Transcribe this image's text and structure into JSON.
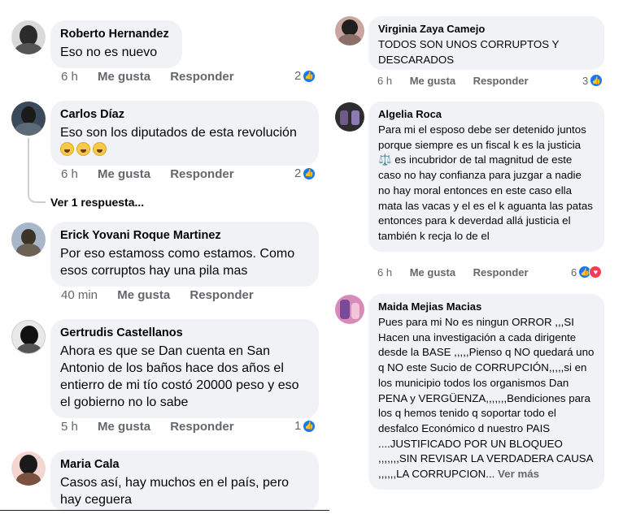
{
  "left_comments": [
    {
      "author": "Roberto Hernandez",
      "text": "Eso no es nuevo",
      "time": "6 h",
      "like_label": "Me gusta",
      "reply_label": "Responder",
      "reactions": "2",
      "avatar_colors": [
        "#d9d9d9",
        "#2b2b2b"
      ]
    },
    {
      "author": "Carlos Díaz",
      "text": "Eso son los diputados de esta revolución",
      "emojis": [
        "rofl-emoji",
        "grin-emoji",
        "smile-emoji"
      ],
      "time": "6 h",
      "like_label": "Me gusta",
      "reply_label": "Responder",
      "reactions": "2",
      "view_replies": "Ver 1 respuesta...",
      "avatar_colors": [
        "#3b4a5a",
        "#1a1a1a"
      ]
    },
    {
      "author": "Erick Yovani Roque Martinez",
      "text": "Por eso estamoss como estamos. Como esos corruptos hay una pila mas",
      "time": "40 min",
      "like_label": "Me gusta",
      "reply_label": "Responder",
      "avatar_colors": [
        "#a7b6c8",
        "#3d3428"
      ]
    },
    {
      "author": "Gertrudis Castellanos",
      "text": "Ahora es que se Dan cuenta en San Antonio de los baños hace dos años el entierro de mi tío costó 20000 peso y eso el gobierno no lo sabe",
      "time": "5 h",
      "like_label": "Me gusta",
      "reply_label": "Responder",
      "reactions": "1",
      "avatar_colors": [
        "#e8e8e8",
        "#111111"
      ]
    },
    {
      "author": "Maria Cala",
      "text": "Casos así,  hay muchos  en el país,  pero hay ceguera",
      "avatar_colors": [
        "#f4d5d0",
        "#1a1a1a"
      ]
    }
  ],
  "right_comments": [
    {
      "author": "Virginia Zaya Camejo",
      "text": "TODOS SON UNOS CORRUPTOS Y DESCARADOS",
      "time": "6 h",
      "like_label": "Me gusta",
      "reply_label": "Responder",
      "reactions": "3",
      "avatar_colors": [
        "#c9a7a0",
        "#1f1f1f"
      ]
    },
    {
      "author": "Algelia Roca",
      "text": "Para mi el esposo debe  ser detenido juntos porque  siempre es un fiscal k es la justicia ⚖️ es incubridor  de tal magnitud  de este caso no hay confianza para juzgar a nadie no hay moral entonces en este caso ella mata las vacas y el es el k aguanta las patas entonces  para k deverdad allá  justicia el también  k recja lo de el",
      "time": "6 h",
      "like_label": "Me gusta",
      "reply_label": "Responder",
      "reactions": "6",
      "avatar_colors": [
        "#2d2d2d",
        "#6e5b8a"
      ]
    },
    {
      "author": "Maida Mejias Macias",
      "text": "Pues para mi No es ningun ORROR ,,,SI Hacen una investigación a cada dirigente desde la BASE ,,,,,Pienso q NO quedará uno q NO este Sucio de CORRUPCIÓN,,,,,si en los municipio todos los organismos Dan PENA y VERGÜENZA,,,,,,,Bendiciones para los q hemos tenido q soportar todo el desfalco Económico d nuestro PAIS ....JUSTIFICADO POR UN BLOQUEO ,,,,,,,SIN REVISAR LA VERDADERA CAUSA ,,,,,,LA CORRUPCION...",
      "see_more": "Ver más",
      "avatar_colors": [
        "#d88bb8",
        "#7a4a9a"
      ]
    }
  ]
}
